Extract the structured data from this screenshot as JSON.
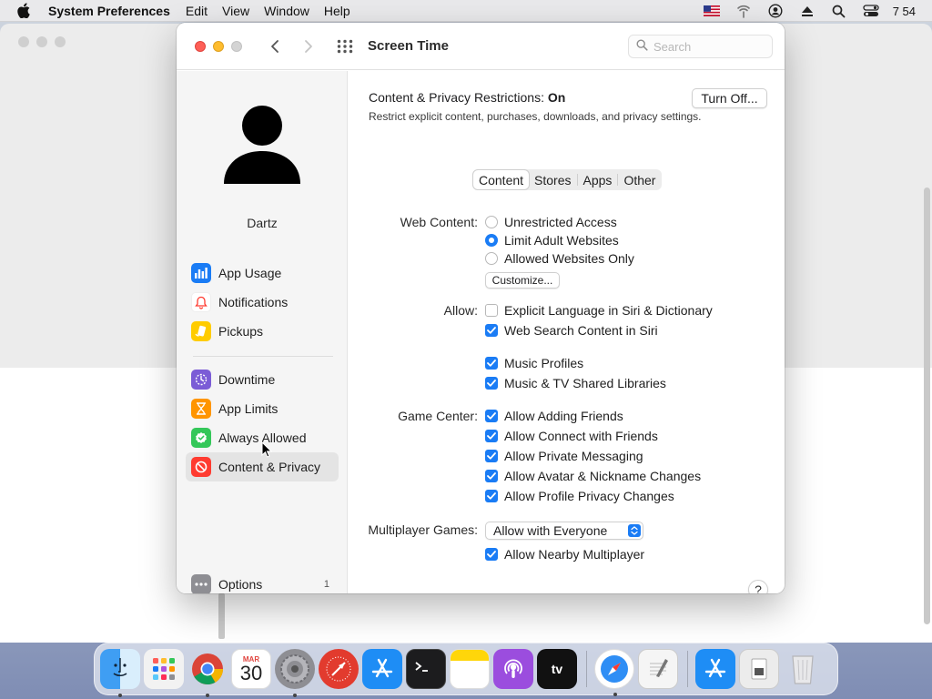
{
  "menubar": {
    "app_name": "System Preferences",
    "menus": [
      "Edit",
      "View",
      "Window",
      "Help"
    ],
    "clock": "7 54"
  },
  "window": {
    "title": "Screen Time",
    "search_placeholder": "Search"
  },
  "sidebar": {
    "user_name": "Dartz",
    "items": [
      {
        "label": "App Usage",
        "icon": "bar-chart-icon",
        "color": "#1a7cf5"
      },
      {
        "label": "Notifications",
        "icon": "bell-icon",
        "color": "#ff3b30"
      },
      {
        "label": "Pickups",
        "icon": "pickup-icon",
        "color": "#ffcc00"
      },
      {
        "label": "Downtime",
        "icon": "downtime-icon",
        "color": "#7b5cd6"
      },
      {
        "label": "App Limits",
        "icon": "hourglass-icon",
        "color": "#ff9500"
      },
      {
        "label": "Always Allowed",
        "icon": "check-badge-icon",
        "color": "#34c759"
      },
      {
        "label": "Content & Privacy",
        "icon": "no-entry-icon",
        "color": "#ff3b30"
      }
    ],
    "options_label": "Options",
    "options_badge": "1"
  },
  "content": {
    "restrictions_label": "Content & Privacy Restrictions:",
    "restrictions_state": "On",
    "description": "Restrict explicit content, purchases, downloads, and privacy settings.",
    "turn_off_button": "Turn Off...",
    "tabs": [
      "Content",
      "Stores",
      "Apps",
      "Other"
    ],
    "selected_tab": "Content",
    "web_content": {
      "label": "Web Content:",
      "options": [
        "Unrestricted Access",
        "Limit Adult Websites",
        "Allowed Websites Only"
      ],
      "selected": "Limit Adult Websites",
      "customize_button": "Customize..."
    },
    "allow": {
      "label": "Allow:",
      "items": [
        {
          "label": "Explicit Language in Siri & Dictionary",
          "checked": false
        },
        {
          "label": "Web Search Content in Siri",
          "checked": true
        },
        {
          "label": "Music Profiles",
          "checked": true
        },
        {
          "label": "Music & TV Shared Libraries",
          "checked": true
        }
      ]
    },
    "game_center": {
      "label": "Game Center:",
      "items": [
        {
          "label": "Allow Adding Friends",
          "checked": true
        },
        {
          "label": "Allow Connect with Friends",
          "checked": true
        },
        {
          "label": "Allow Private Messaging",
          "checked": true
        },
        {
          "label": "Allow Avatar & Nickname Changes",
          "checked": true
        },
        {
          "label": "Allow Profile Privacy Changes",
          "checked": true
        }
      ]
    },
    "multiplayer": {
      "label": "Multiplayer Games:",
      "value": "Allow with Everyone",
      "nearby_label": "Allow Nearby Multiplayer",
      "nearby_checked": true
    },
    "help_label": "?"
  },
  "dock": {
    "calendar_month": "MAR",
    "calendar_day": "30",
    "tv_label": "tv"
  }
}
